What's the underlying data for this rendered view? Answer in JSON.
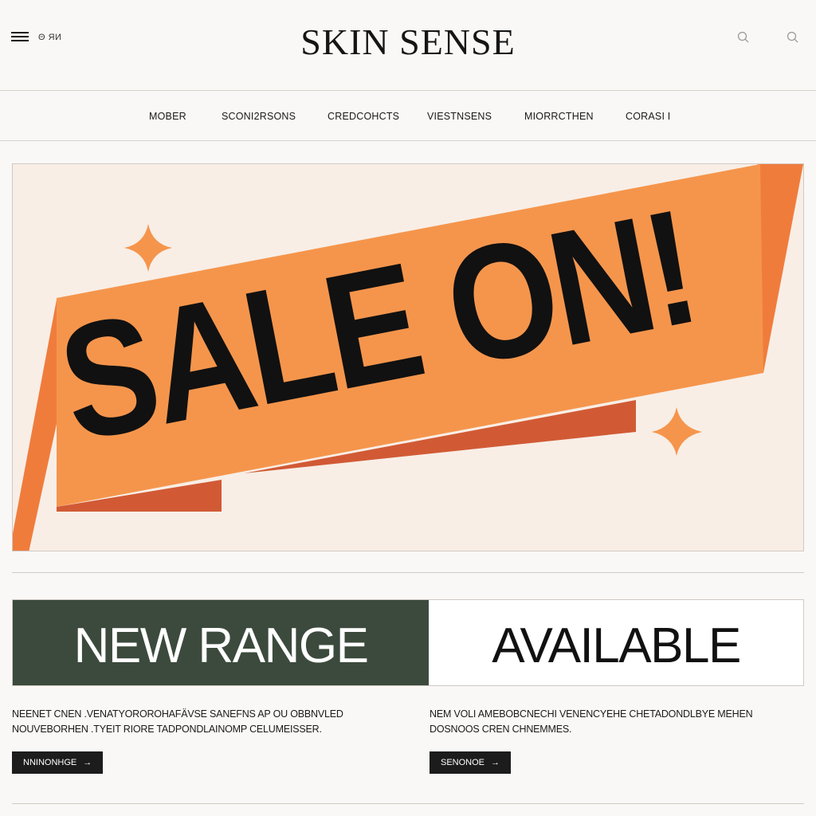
{
  "header": {
    "small_text": "Θ ЯИ",
    "brand": "SKIN SENSE"
  },
  "nav": {
    "items": [
      {
        "label": "MOBER"
      },
      {
        "label": "SCONI2RSONS"
      },
      {
        "label": "CREDCOHCTS"
      },
      {
        "label": "VIESTNSENS"
      },
      {
        "label": "MIORRCTHEN"
      },
      {
        "label": "CORASI I"
      }
    ]
  },
  "hero": {
    "headline": "SALE ON!",
    "colors": {
      "background": "#f8eee6",
      "ribbon": "#f5954c",
      "ribbon_dark": "#f07c3c",
      "ribbon_shadow": "#d15a35",
      "sparkle": "#f5954c",
      "text": "#111111"
    }
  },
  "range": {
    "left_text": "NEW RANGE",
    "right_text": "AVAILABLE",
    "left_bg": "#3b4a3c"
  },
  "columns": [
    {
      "text": "NEENET CNEN .VENATYOROROHAFÄVSE SANEFNS AP OU OBBNVLED NOUVEBORHEN .TYEIT RIORE TADPONDLAINOMP CELUMEISSER.",
      "button": "NNINONHGE",
      "button_icon": "arrow-right-icon"
    },
    {
      "text": "NEM VOLI AMEBOBCNECHI VENENCYEHE CHETADONDLBYE MEHEN DOSNOOS CREN CHNEMMES.",
      "button": "SENONOE",
      "button_icon": "arrow-right-icon"
    }
  ]
}
